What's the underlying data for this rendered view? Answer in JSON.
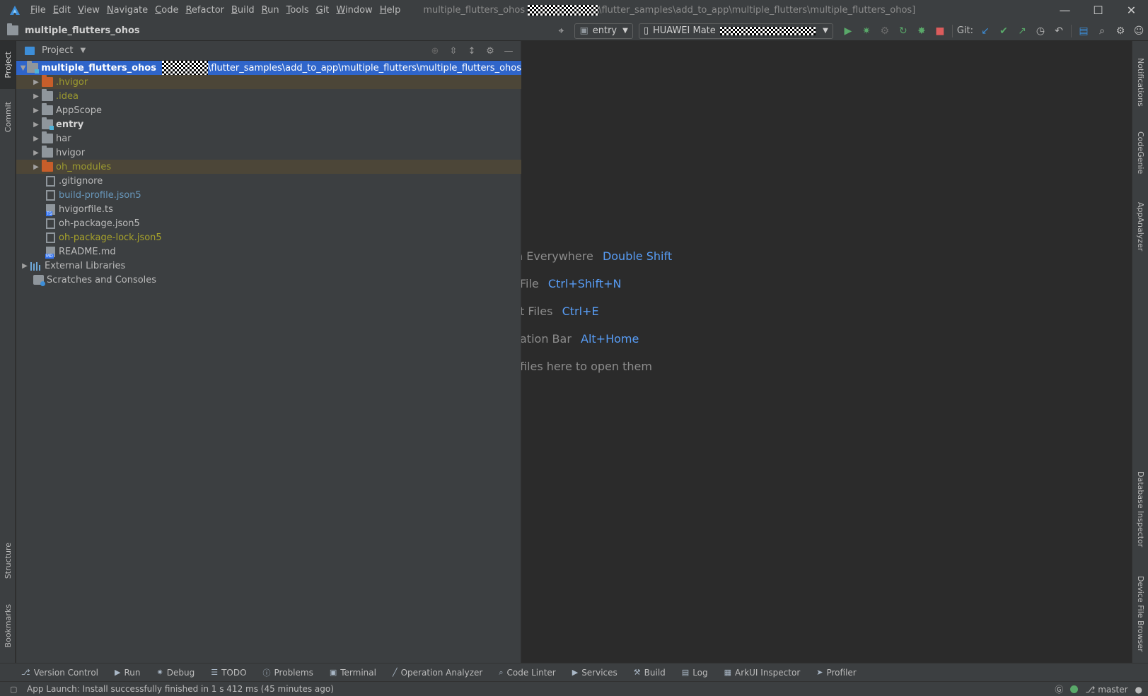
{
  "menu": [
    {
      "mnemonic": "F",
      "rest": "ile"
    },
    {
      "mnemonic": "E",
      "rest": "dit"
    },
    {
      "mnemonic": "V",
      "rest": "iew"
    },
    {
      "mnemonic": "N",
      "rest": "avigate"
    },
    {
      "mnemonic": "C",
      "rest": "ode"
    },
    {
      "mnemonic": "R",
      "rest": "efactor"
    },
    {
      "mnemonic": "B",
      "rest": "uild"
    },
    {
      "mnemonic": "R",
      "rest": "un"
    },
    {
      "mnemonic": "T",
      "rest": "ools"
    },
    {
      "mnemonic": "G",
      "rest": "it"
    },
    {
      "mnemonic": "W",
      "rest": "indow"
    },
    {
      "mnemonic": "H",
      "rest": "elp"
    }
  ],
  "window_title": {
    "project": "multiple_flutters_ohos",
    "path_suffix": "\\flutter_samples\\add_to_app\\multiple_flutters\\multiple_flutters_ohos]"
  },
  "toolbar": {
    "breadcrumb": "multiple_flutters_ohos",
    "run_config": "entry",
    "device_prefix": "HUAWEI Mate",
    "git_label": "Git:"
  },
  "left_tabs": {
    "project": "Project",
    "commit": "Commit",
    "structure": "Structure",
    "bookmarks": "Bookmarks"
  },
  "right_tabs": {
    "notifications": "Notifications",
    "codegenie": "CodeGenie",
    "appanalyzer": "AppAnalyzer",
    "database": "Database Inspector",
    "device_file": "Device File Browser"
  },
  "project_panel": {
    "title": "Project",
    "root": {
      "name": "multiple_flutters_ohos",
      "path_suffix": "\\flutter_samples\\add_to_app\\multiple_flutters\\multiple_flutters_ohos"
    },
    "items": [
      {
        "label": ".hvigor"
      },
      {
        "label": ".idea"
      },
      {
        "label": "AppScope"
      },
      {
        "label": "entry"
      },
      {
        "label": "har"
      },
      {
        "label": "hvigor"
      },
      {
        "label": "oh_modules"
      },
      {
        "label": ".gitignore"
      },
      {
        "label": "build-profile.json5"
      },
      {
        "label": "hvigorfile.ts"
      },
      {
        "label": "oh-package.json5"
      },
      {
        "label": "oh-package-lock.json5"
      },
      {
        "label": "README.md"
      }
    ],
    "external_libraries": "External Libraries",
    "scratches": "Scratches and Consoles"
  },
  "editor_hints": [
    {
      "label": "n Everywhere",
      "key": "Double Shift"
    },
    {
      "label": "File",
      "key": "Ctrl+Shift+N"
    },
    {
      "label": "t Files",
      "key": "Ctrl+E"
    },
    {
      "label": "ation Bar",
      "key": "Alt+Home"
    },
    {
      "label": "files here to open them",
      "key": ""
    }
  ],
  "bottom_tabs": [
    "Version Control",
    "Run",
    "Debug",
    "TODO",
    "Problems",
    "Terminal",
    "Operation Analyzer",
    "Code Linter",
    "Services",
    "Build",
    "Log",
    "ArkUI Inspector",
    "Profiler"
  ],
  "status": {
    "message": "App Launch: Install successfully finished in 1 s 412 ms (45 minutes ago)",
    "branch": "master"
  },
  "colors": {
    "selection": "#2f65ca",
    "excluded_bg": "#4c4638",
    "shortcut_blue": "#589df6",
    "run_green": "#59a869",
    "stop_red": "#db5c5c"
  }
}
